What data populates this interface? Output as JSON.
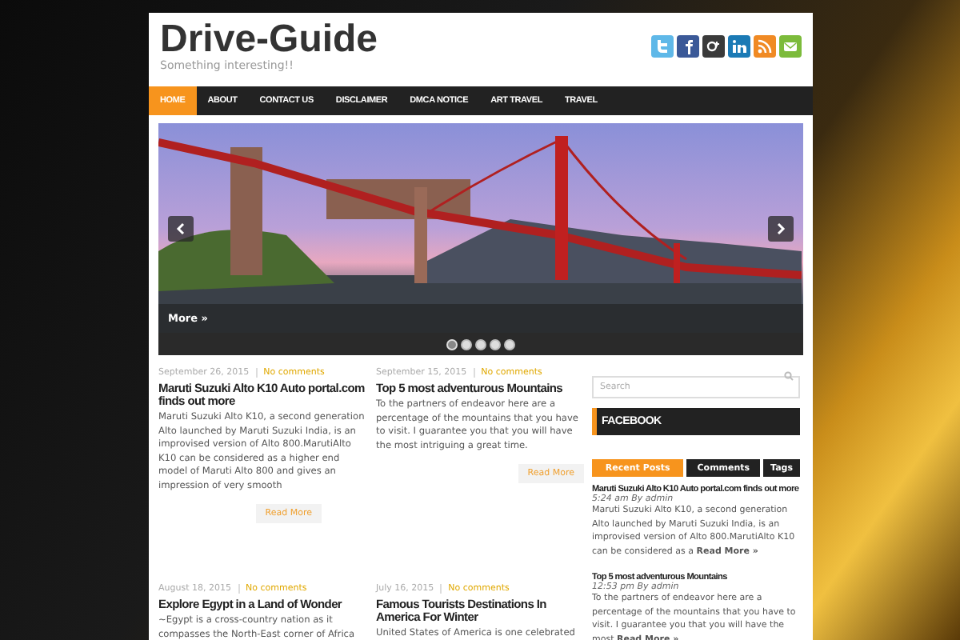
{
  "site": {
    "title": "Drive-Guide",
    "tagline": "Something interesting!!"
  },
  "social": [
    {
      "kind": "twitter",
      "color": "#5fb8e8"
    },
    {
      "kind": "facebook",
      "color": "#3b5998"
    },
    {
      "kind": "googleplus",
      "color": "#3a3a3a"
    },
    {
      "kind": "linkedin",
      "color": "#1b7ab5"
    },
    {
      "kind": "rss",
      "color": "#f08a24"
    },
    {
      "kind": "email",
      "color": "#7cbb3b"
    }
  ],
  "nav": [
    {
      "label": "HOME",
      "selected": true
    },
    {
      "label": "ABOUT",
      "selected": false
    },
    {
      "label": "CONTACT US",
      "selected": false
    },
    {
      "label": "DISCLAIMER",
      "selected": false
    },
    {
      "label": "DMCA NOTICE",
      "selected": false
    },
    {
      "label": "ART TRAVEL",
      "selected": false
    },
    {
      "label": "TRAVEL",
      "selected": false
    }
  ],
  "slider": {
    "caption": "More »",
    "dots": [
      {
        "selected": true
      },
      {
        "selected": false
      },
      {
        "selected": false
      },
      {
        "selected": false
      },
      {
        "selected": false
      }
    ]
  },
  "posts": [
    {
      "date": "September 26, 2015",
      "comments": "No comments",
      "title": "Maruti Suzuki Alto K10 Auto portal.com finds out more",
      "excerpt": "Maruti Suzuki Alto K10, a second generation Alto launched by Maruti Suzuki India, is an improvised version of Alto 800.MarutiAlto K10 can be considered as a higher end model of Maruti Alto 800 and gives an impression of very smooth",
      "read_more": "Read More"
    },
    {
      "date": "September 15, 2015",
      "comments": "No comments",
      "title": "Top 5 most adventurous Mountains",
      "excerpt": "To the partners of endeavor here are a percentage of the mountains that you have to visit. I guarantee you that you will have the most intriguing a great time.",
      "read_more": "Read More"
    },
    {
      "date": "August 18, 2015",
      "comments": "No comments",
      "title": "Explore Egypt in a Land of Wonder",
      "excerpt": "~Egypt is a cross-country nation as it compasses the North-East corner of Africa"
    },
    {
      "date": "July 16, 2015",
      "comments": "No comments",
      "title": "Famous Tourists Destinations In America For Winter",
      "excerpt": "United States of America is one celebrated"
    }
  ],
  "sidebar": {
    "search": {
      "placeholder": "Search"
    },
    "facebook_title": "FACEBOOK",
    "tabs": [
      {
        "label": "Recent Posts",
        "selected": true
      },
      {
        "label": "Comments",
        "selected": false
      },
      {
        "label": "Tags",
        "selected": false
      }
    ],
    "recent": [
      {
        "title": "Maruti Suzuki Alto K10 Auto portal.com finds out more",
        "meta": "5:24 am By admin",
        "excerpt": "Maruti Suzuki Alto K10, a second generation Alto launched by Maruti Suzuki India, is an improvised version of Alto 800.MarutiAlto K10 can be considered as a **Read More »**"
      },
      {
        "title": "Top 5 most adventurous Mountains",
        "meta": "12:53 pm By admin",
        "excerpt": "To the partners of endeavor here are a percentage of the mountains that you have to visit. I guarantee you that you will have the most **Read More »**"
      }
    ]
  }
}
